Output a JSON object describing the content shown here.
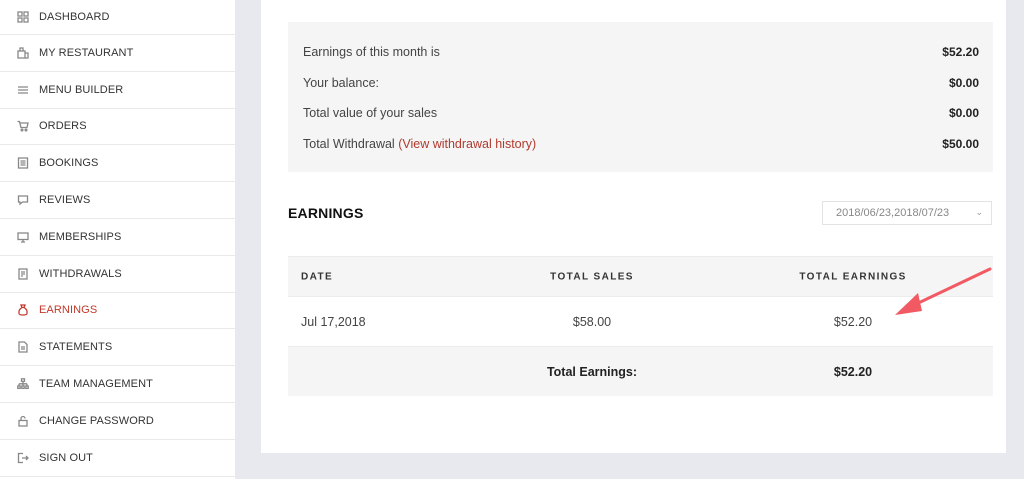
{
  "sidebar": {
    "items": [
      {
        "label": "DASHBOARD",
        "icon": "dashboard-icon",
        "active": false
      },
      {
        "label": "MY RESTAURANT",
        "icon": "restaurant-icon",
        "active": false
      },
      {
        "label": "MENU BUILDER",
        "icon": "menu-lines-icon",
        "active": false
      },
      {
        "label": "ORDERS",
        "icon": "cart-icon",
        "active": false
      },
      {
        "label": "BOOKINGS",
        "icon": "document-icon",
        "active": false
      },
      {
        "label": "REVIEWS",
        "icon": "comment-icon",
        "active": false
      },
      {
        "label": "MEMBERSHIPS",
        "icon": "monitor-icon",
        "active": false
      },
      {
        "label": "WITHDRAWALS",
        "icon": "receipt-icon",
        "active": false
      },
      {
        "label": "EARNINGS",
        "icon": "money-bag-icon",
        "active": true
      },
      {
        "label": "STATEMENTS",
        "icon": "statement-icon",
        "active": false
      },
      {
        "label": "TEAM MANAGEMENT",
        "icon": "org-chart-icon",
        "active": false
      },
      {
        "label": "CHANGE PASSWORD",
        "icon": "lock-icon",
        "active": false
      },
      {
        "label": "SIGN OUT",
        "icon": "sign-out-icon",
        "active": false
      }
    ]
  },
  "summary": {
    "month_label": "Earnings of this month is",
    "month_value": "$52.20",
    "balance_label": "Your balance:",
    "balance_value": "$0.00",
    "sales_label": "Total value of your sales",
    "sales_value": "$0.00",
    "withdrawal_label": "Total Withdrawal",
    "withdrawal_link": "(View withdrawal history)",
    "withdrawal_value": "$50.00"
  },
  "earnings": {
    "title": "EARNINGS",
    "date_range": "2018/06/23,2018/07/23",
    "columns": [
      "DATE",
      "TOTAL SALES",
      "TOTAL EARNINGS"
    ],
    "rows": [
      {
        "date": "Jul 17,2018",
        "sales": "$58.00",
        "earnings": "$52.20"
      }
    ],
    "footer_label": "Total Earnings:",
    "footer_value": "$52.20"
  },
  "colors": {
    "accent": "#c0392b",
    "arrow": "#f25a63"
  }
}
